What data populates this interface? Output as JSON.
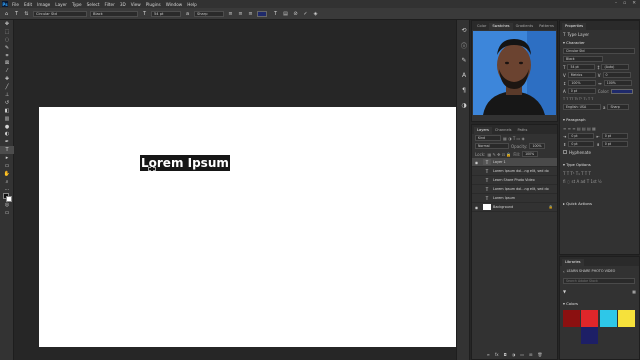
{
  "menubar": {
    "logo": "Ps",
    "items": [
      "File",
      "Edit",
      "Image",
      "Layer",
      "Type",
      "Select",
      "Filter",
      "3D",
      "View",
      "Plugins",
      "Window",
      "Help"
    ]
  },
  "options_bar": {
    "font_family": "Circular Std",
    "font_style": "Black",
    "font_size": "54 pt",
    "antialias": "Sharp",
    "color_swatch": "#1f2a6b"
  },
  "canvas": {
    "text": "Lorem Ipsum",
    "doc_color": "#ffffff",
    "highlight_color": "#161616"
  },
  "swatch_panel": {
    "tabs": [
      "Color",
      "Swatches",
      "Gradients",
      "Patterns"
    ]
  },
  "layers_panel": {
    "tabs": [
      "Layers",
      "Channels",
      "Paths"
    ],
    "kind_label": "Kind",
    "blend_mode": "Normal",
    "opacity_label": "Opacity:",
    "opacity": "100%",
    "lock_label": "Lock:",
    "fill_label": "Fill:",
    "fill": "100%",
    "layers": [
      {
        "name": "Layer 1",
        "icon": "T",
        "selected": true
      },
      {
        "name": "Lorem Ipsum dol...ng elit, sed do",
        "icon": "T"
      },
      {
        "name": "Learn Share Photo Video",
        "icon": "T"
      },
      {
        "name": "Lorem Ipsum dol...ng elit, sed do",
        "icon": "T"
      },
      {
        "name": "Lorem Ipsum",
        "icon": "T"
      },
      {
        "name": "Background",
        "icon": ""
      }
    ]
  },
  "properties": {
    "title": "Properties",
    "kind": "Type Layer",
    "character_title": "Character",
    "font_family": "Circular Std",
    "font_style": "Black",
    "size": "54 pt",
    "leading": "(Auto)",
    "tracking": "Metrics",
    "kerning": "0",
    "vscale": "100%",
    "hscale": "100%",
    "baseline": "0 pt",
    "color_label": "Color:",
    "language": "English: USA",
    "aa": "Sharp",
    "paragraph_title": "Paragraph",
    "indent1": "0 pt",
    "indent2": "0 pt",
    "indent3": "0 pt",
    "indent4": "0 pt",
    "hyphenate": "Hyphenate",
    "type_options_title": "Type Options",
    "quick_actions_title": "Quick Actions"
  },
  "libraries": {
    "title": "Libraries",
    "library_name": "LEARN SHARE PHOTO VIDEO",
    "search_placeholder": "Search Adobe Stock",
    "colors_title": "Colors",
    "swatches": [
      "#8b1010",
      "#e0262a",
      "#2ec7e8",
      "#f6e13b",
      "#f26a21",
      "#1d1f66"
    ]
  }
}
